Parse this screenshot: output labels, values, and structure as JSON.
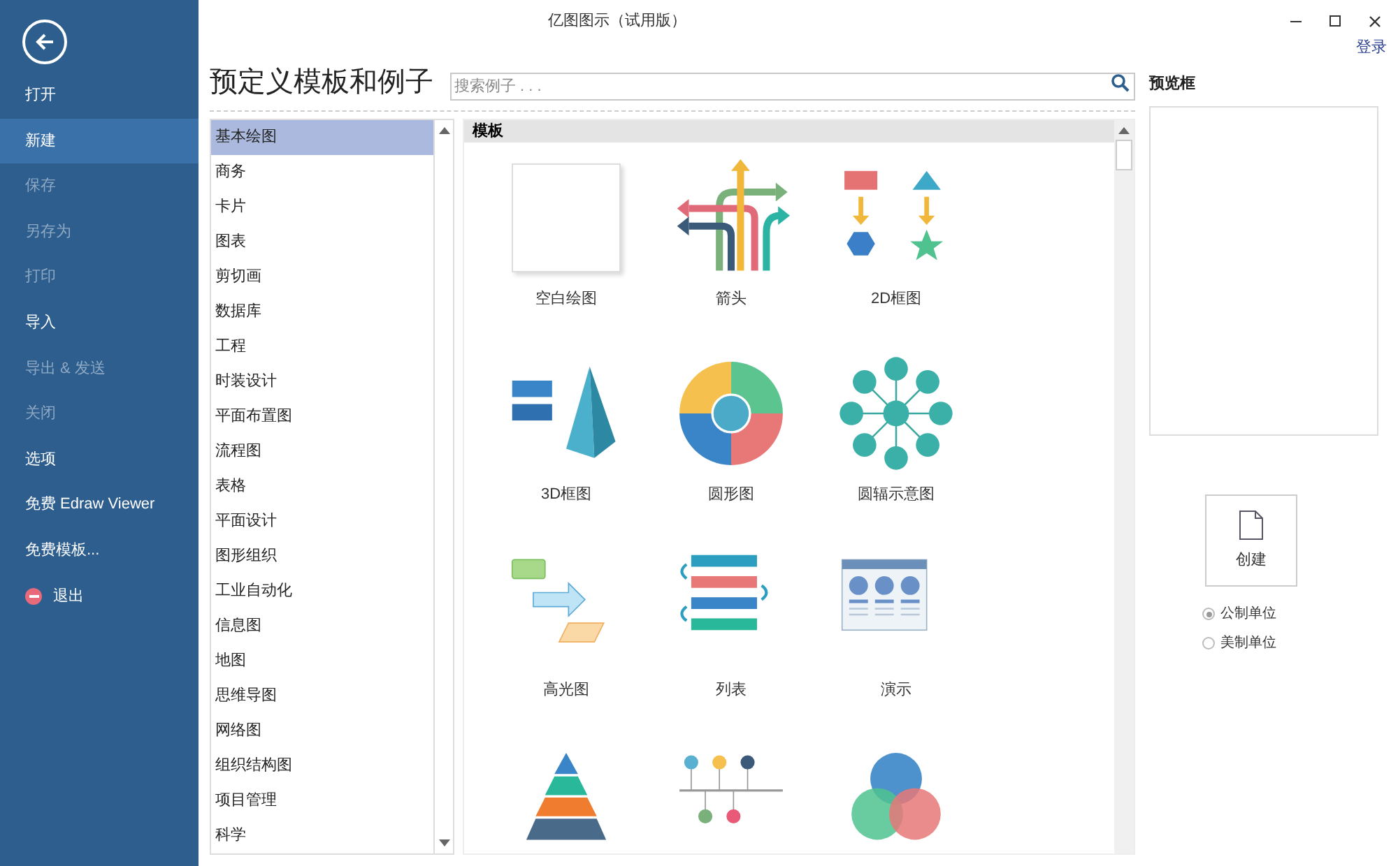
{
  "window": {
    "title": "亿图图示（试用版）",
    "login": "登录"
  },
  "sidebar": {
    "items": [
      {
        "kind": "item",
        "label": "打开",
        "selected": false,
        "disabled": false
      },
      {
        "kind": "item",
        "label": "新建",
        "selected": true,
        "disabled": false
      },
      {
        "kind": "item",
        "label": "保存",
        "selected": false,
        "disabled": true
      },
      {
        "kind": "item",
        "label": "另存为",
        "selected": false,
        "disabled": true
      },
      {
        "kind": "item",
        "label": "打印",
        "selected": false,
        "disabled": true
      },
      {
        "kind": "item",
        "label": "导入",
        "selected": false,
        "disabled": false
      },
      {
        "kind": "item",
        "label": "导出 & 发送",
        "selected": false,
        "disabled": true
      },
      {
        "kind": "item",
        "label": "关闭",
        "selected": false,
        "disabled": true
      },
      {
        "kind": "item",
        "label": "选项",
        "selected": false,
        "disabled": false
      },
      {
        "kind": "item",
        "label": "免费 Edraw Viewer",
        "selected": false,
        "disabled": false
      },
      {
        "kind": "item",
        "label": "免费模板...",
        "selected": false,
        "disabled": false
      },
      {
        "kind": "exit",
        "label": "退出",
        "selected": false,
        "disabled": false
      }
    ]
  },
  "heading": "预定义模板和例子",
  "search": {
    "placeholder": "搜索例子 . . ."
  },
  "categories": [
    {
      "label": "基本绘图",
      "selected": true
    },
    {
      "label": "商务",
      "selected": false
    },
    {
      "label": "卡片",
      "selected": false
    },
    {
      "label": "图表",
      "selected": false
    },
    {
      "label": "剪切画",
      "selected": false
    },
    {
      "label": "数据库",
      "selected": false
    },
    {
      "label": "工程",
      "selected": false
    },
    {
      "label": "时装设计",
      "selected": false
    },
    {
      "label": "平面布置图",
      "selected": false
    },
    {
      "label": "流程图",
      "selected": false
    },
    {
      "label": "表格",
      "selected": false
    },
    {
      "label": "平面设计",
      "selected": false
    },
    {
      "label": "图形组织",
      "selected": false
    },
    {
      "label": "工业自动化",
      "selected": false
    },
    {
      "label": "信息图",
      "selected": false
    },
    {
      "label": "地图",
      "selected": false
    },
    {
      "label": "思维导图",
      "selected": false
    },
    {
      "label": "网络图",
      "selected": false
    },
    {
      "label": "组织结构图",
      "selected": false
    },
    {
      "label": "项目管理",
      "selected": false
    },
    {
      "label": "科学",
      "selected": false
    }
  ],
  "templates": {
    "header": "模板",
    "items": [
      {
        "kind": "blank",
        "label": "空白绘图"
      },
      {
        "kind": "arrows",
        "label": "箭头"
      },
      {
        "kind": "blocks2d",
        "label": "2D框图"
      },
      {
        "kind": "blocks3d",
        "label": "3D框图"
      },
      {
        "kind": "circular",
        "label": "圆形图"
      },
      {
        "kind": "radial",
        "label": "圆辐示意图"
      },
      {
        "kind": "highlight",
        "label": "高光图"
      },
      {
        "kind": "list",
        "label": "列表"
      },
      {
        "kind": "presentation",
        "label": "演示"
      },
      {
        "kind": "pyramid"
      },
      {
        "kind": "timeline"
      },
      {
        "kind": "venn"
      }
    ]
  },
  "preview": {
    "title": "预览框"
  },
  "create": {
    "label": "创建"
  },
  "units": [
    {
      "label": "公制单位",
      "selected": true
    },
    {
      "label": "美制单位",
      "selected": false
    }
  ]
}
